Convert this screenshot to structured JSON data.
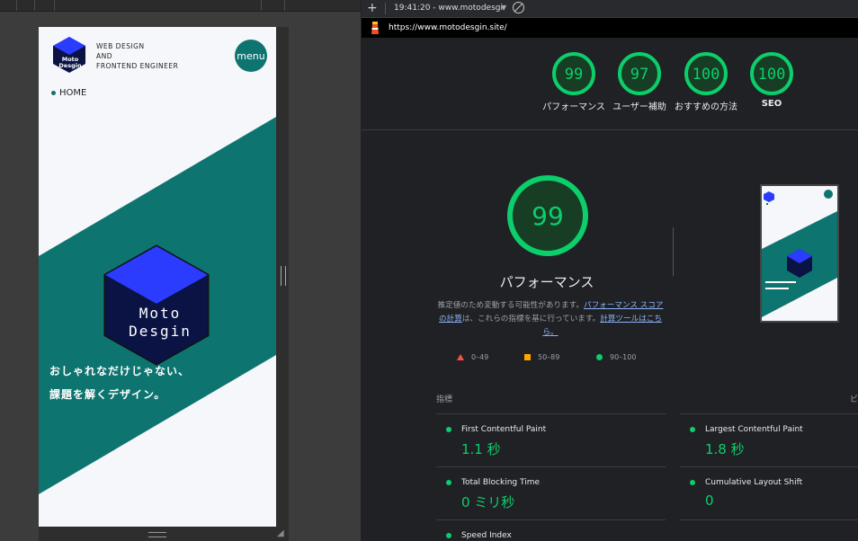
{
  "site": {
    "logo_line1": "Moto",
    "logo_line2": "Desgin",
    "tagline_lines": [
      "WEB DESIGN",
      "AND",
      "FRONTEND ENGINEER"
    ],
    "menu_label": "menu",
    "home_label": "HOME",
    "hero_line1": "Moto",
    "hero_line2": "Desgin",
    "catch_line1": "おしゃれなだけじゃない、",
    "catch_line2": "課題を解くデザイン。"
  },
  "toolbar": {
    "report_label": "19:41:20 - www.motodesgi",
    "url": "https://www.motodesgin.site/"
  },
  "scores": [
    {
      "value": 99,
      "label": "パフォーマンス"
    },
    {
      "value": 97,
      "label": "ユーザー補助"
    },
    {
      "value": 100,
      "label": "おすすめの方法"
    },
    {
      "value": 100,
      "label": "SEO"
    }
  ],
  "performance": {
    "score": 99,
    "title": "パフォーマンス",
    "desc_part1": "推定値のため変動する可能性があります。",
    "desc_link1": "パフォーマンス スコアの計算",
    "desc_part2": "は、これらの指標を基に行っています。",
    "desc_link2": "計算ツールはこちら。"
  },
  "legend": [
    {
      "range": "0–49",
      "shape": "triangle",
      "color": "#ff4e42"
    },
    {
      "range": "50–89",
      "shape": "square",
      "color": "#ffa400"
    },
    {
      "range": "90–100",
      "shape": "circle",
      "color": "#0cce6b"
    }
  ],
  "metrics_header": "指標",
  "expand_hint": "ビ",
  "metrics": [
    {
      "name": "First Contentful Paint",
      "value": "1.1 秒"
    },
    {
      "name": "Largest Contentful Paint",
      "value": "1.8 秒"
    },
    {
      "name": "Total Blocking Time",
      "value": "0 ミリ秒"
    },
    {
      "name": "Cumulative Layout Shift",
      "value": "0"
    },
    {
      "name": "Speed Index",
      "value": ""
    }
  ],
  "colors": {
    "accent_teal": "#0e7470",
    "cube_blue": "#2b3cff",
    "pass_green": "#0cce6b"
  }
}
